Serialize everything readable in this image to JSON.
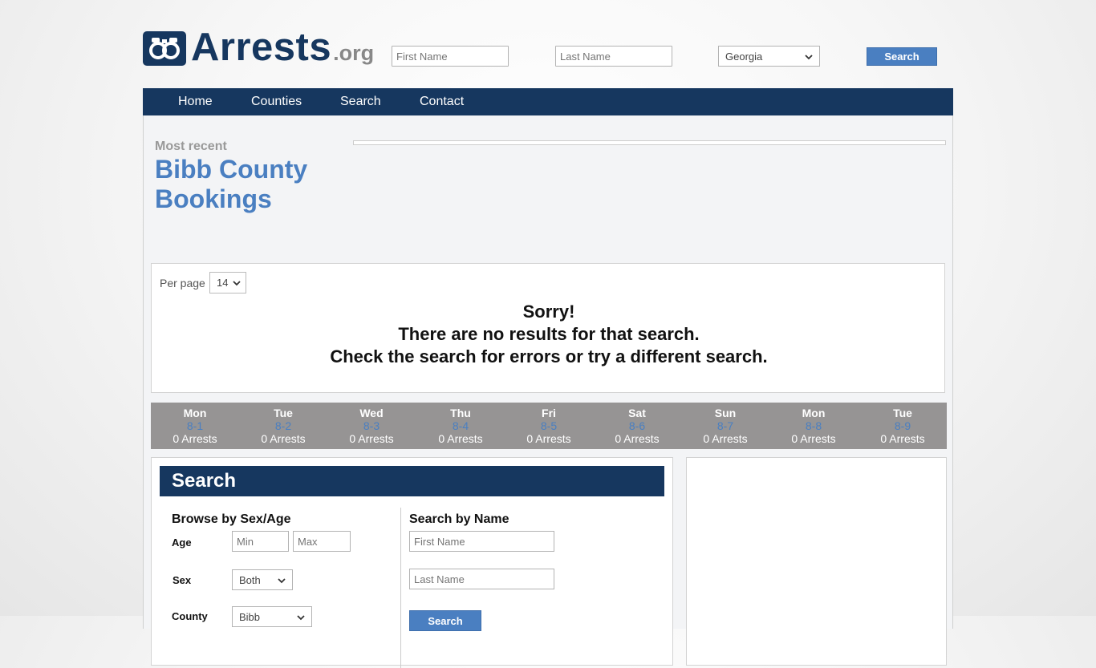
{
  "header": {
    "logo_main": "Arrests",
    "logo_tld": ".org",
    "first_name_placeholder": "First Name",
    "last_name_placeholder": "Last Name",
    "state_selected": "Georgia",
    "search_label": "Search"
  },
  "nav": {
    "items": [
      "Home",
      "Counties",
      "Search",
      "Contact"
    ]
  },
  "page": {
    "most_recent": "Most recent",
    "title": "Bibb County Bookings"
  },
  "results": {
    "per_page_label": "Per page",
    "per_page_value": "14",
    "sorry_line1": "Sorry!",
    "sorry_line2": "There are no results for that search.",
    "sorry_line3": "Check the search for errors or try a different search."
  },
  "days": [
    {
      "name": "Mon",
      "date": "8-1",
      "arrests": "0 Arrests"
    },
    {
      "name": "Tue",
      "date": "8-2",
      "arrests": "0 Arrests"
    },
    {
      "name": "Wed",
      "date": "8-3",
      "arrests": "0 Arrests"
    },
    {
      "name": "Thu",
      "date": "8-4",
      "arrests": "0 Arrests"
    },
    {
      "name": "Fri",
      "date": "8-5",
      "arrests": "0 Arrests"
    },
    {
      "name": "Sat",
      "date": "8-6",
      "arrests": "0 Arrests"
    },
    {
      "name": "Sun",
      "date": "8-7",
      "arrests": "0 Arrests"
    },
    {
      "name": "Mon",
      "date": "8-8",
      "arrests": "0 Arrests"
    },
    {
      "name": "Tue",
      "date": "8-9",
      "arrests": "0 Arrests"
    }
  ],
  "search_panel": {
    "heading": "Search",
    "browse_heading": "Browse by Sex/Age",
    "age_label": "Age",
    "age_min_placeholder": "Min",
    "age_max_placeholder": "Max",
    "sex_label": "Sex",
    "sex_value": "Both",
    "county_label": "County",
    "county_value": "Bibb",
    "name_heading": "Search by Name",
    "first_name_placeholder": "First Name",
    "last_name_placeholder": "Last Name",
    "search_label": "Search"
  },
  "colors": {
    "navy": "#16375f",
    "accent_blue": "#4a7fc1",
    "day_bar": "#969494"
  }
}
